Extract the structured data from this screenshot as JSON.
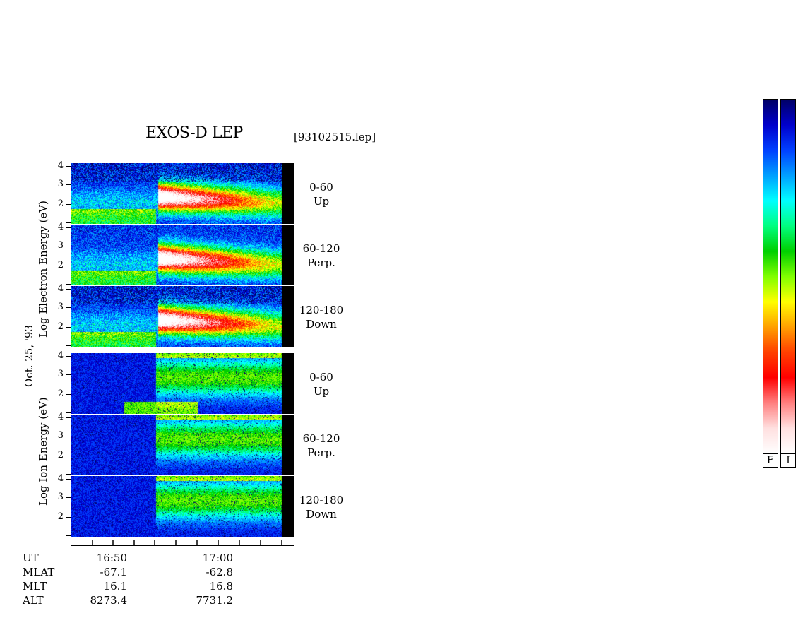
{
  "header": {
    "title": "EXOS-D LEP",
    "filename": "[93102515.lep]"
  },
  "axis_labels": {
    "electron": "Log  Electron  Energy  (eV)",
    "ion": "Log   Ion   Energy  (eV)",
    "date": "Oct. 25, '93"
  },
  "panels": [
    {
      "pitch": "0-60",
      "dir": "Up",
      "species": "electron"
    },
    {
      "pitch": "60-120",
      "dir": "Perp.",
      "species": "electron"
    },
    {
      "pitch": "120-180",
      "dir": "Down",
      "species": "electron"
    },
    {
      "pitch": "0-60",
      "dir": "Up",
      "species": "ion"
    },
    {
      "pitch": "60-120",
      "dir": "Perp.",
      "species": "ion"
    },
    {
      "pitch": "120-180",
      "dir": "Down",
      "species": "ion"
    }
  ],
  "footer": {
    "rows": [
      "UT",
      "MLAT",
      "MLT",
      "ALT"
    ],
    "col1": [
      "16:50",
      "-67.1",
      "16.1",
      "8273.4"
    ],
    "col2": [
      "17:00",
      "-62.8",
      "16.8",
      "7731.2"
    ]
  },
  "colorbars": [
    {
      "label": "E"
    },
    {
      "label": "I"
    }
  ],
  "colors": {
    "scale": [
      "#000066",
      "#0000cc",
      "#0040ff",
      "#00a0ff",
      "#00ffff",
      "#00ff80",
      "#00d000",
      "#80ff00",
      "#ffff00",
      "#ffa000",
      "#ff4000",
      "#ff0000",
      "#ff8080",
      "#ffe0e0",
      "#ffffff"
    ]
  },
  "chart_data": {
    "type": "heatmap",
    "title": "EXOS-D LEP",
    "xlabel": "UT",
    "x_tick_labels": [
      "16:50",
      "17:00"
    ],
    "ylabel": "Log Energy (eV)",
    "y_tick_labels": [
      "2",
      "3",
      "4"
    ],
    "ylim": [
      1,
      4
    ],
    "series": [
      {
        "name": "0-60 Up",
        "values": [
          1,
          1,
          1,
          4,
          3,
          2
        ]
      },
      {
        "name": "60-120 Perp.",
        "values": [
          1,
          1,
          1,
          4,
          3,
          2
        ]
      },
      {
        "name": "120-180 Down",
        "values": [
          1,
          1,
          1,
          4,
          3,
          2
        ]
      },
      {
        "name": "0-60 Up",
        "values": [
          1,
          1,
          1,
          3,
          2,
          1
        ]
      },
      {
        "name": "60-120 Perp.",
        "values": [
          1,
          1,
          1,
          3,
          2,
          1
        ]
      },
      {
        "name": "120-180 Down",
        "values": [
          1,
          1,
          1,
          3,
          2,
          1
        ]
      }
    ]
  }
}
